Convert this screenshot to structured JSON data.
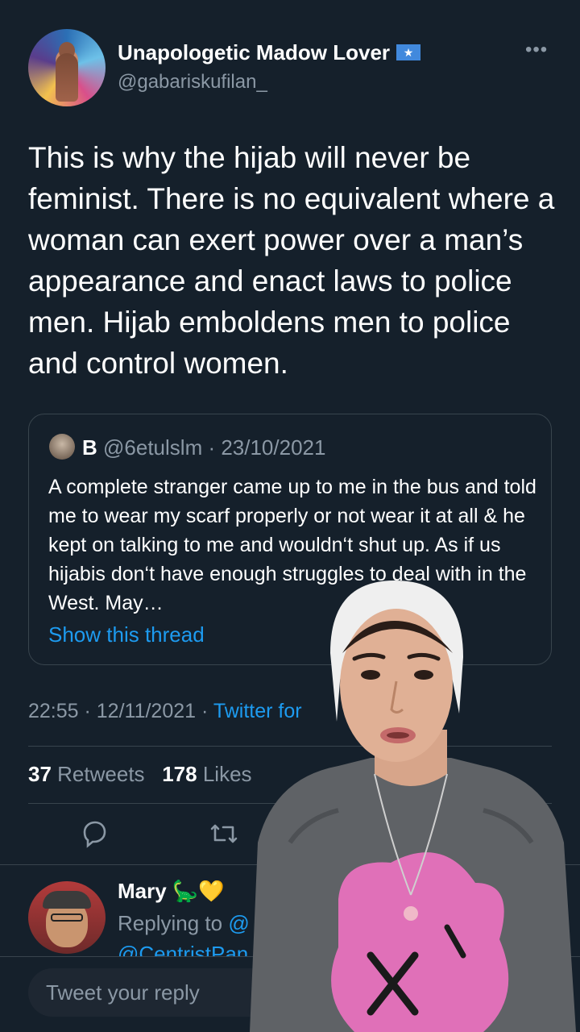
{
  "author": {
    "display_name": "Unapologetic Madow Lover",
    "flag_icon": "somalia-flag-icon",
    "handle": "@gabariskufilan_"
  },
  "tweet": {
    "text": "This is why the hijab will never be feminist. There is no equivalent where a woman can exert power over a man’s appearance and enact laws to police men. Hijab emboldens men to police and control women."
  },
  "quoted": {
    "name": "B",
    "meta": "@6etulslm · 23/10/2021",
    "text": "A complete stranger came up to me in the bus and told me to wear my scarf properly or not wear it at all & he kept on talking to me and wouldn‘t shut up. As if us hijabis don‘t have enough struggles to deal with in the West. May…",
    "show_thread": "Show this thread"
  },
  "meta": {
    "time": "22:55 · 12/11/2021 · ",
    "source": "Twitter for"
  },
  "stats": {
    "retweets_count": "37",
    "retweets_label": "Retweets",
    "likes_count": "178",
    "likes_label": "Likes"
  },
  "actions": {
    "reply_icon": "reply-icon",
    "retweet_icon": "retweet-icon"
  },
  "reply": {
    "name": "Mary 🦕💛",
    "replying_prefix": "Replying to ",
    "replying_mention": "@",
    "extra_mention": "@CentristPan"
  },
  "composer": {
    "placeholder": "Tweet your reply"
  },
  "colors": {
    "background": "#15202b",
    "accent": "#1d9bf0",
    "muted": "#8b98a5",
    "border": "#38444d"
  }
}
